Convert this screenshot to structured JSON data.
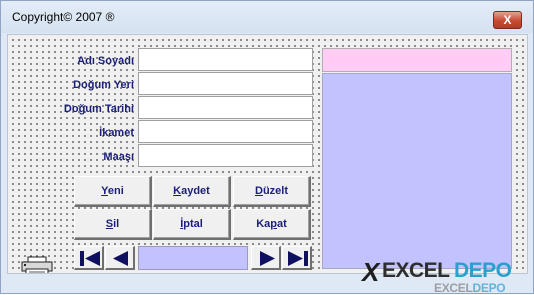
{
  "window": {
    "title": "Copyright© 2007 ®",
    "close_label": "X"
  },
  "form": {
    "fields": [
      {
        "label": "Adı Soyadı",
        "value": ""
      },
      {
        "label": "Doğum Yeri",
        "value": ""
      },
      {
        "label": "Doğum Tarihi",
        "value": ""
      },
      {
        "label": "İkamet",
        "value": ""
      },
      {
        "label": "Maaşı",
        "value": ""
      }
    ],
    "record_value": ""
  },
  "buttons": [
    {
      "accel": "Y",
      "rest": "eni"
    },
    {
      "accel": "K",
      "rest": "aydet"
    },
    {
      "accel": "D",
      "rest": "üzelt"
    },
    {
      "accel": "S",
      "rest": "il"
    },
    {
      "accel": "İ",
      "rest": "ptal"
    },
    {
      "pre": "Ka",
      "accel": "p",
      "rest": "at"
    }
  ],
  "navigation": {
    "first_icon": "first-record-icon",
    "prev_icon": "previous-record-icon",
    "next_icon": "next-record-icon",
    "last_icon": "last-record-icon"
  },
  "logo": {
    "mark": "X",
    "word1": "EXCEL",
    "word2": "DEPO",
    "reflection_word1": "EXCEL",
    "reflection_word2": "DEPO"
  },
  "colors": {
    "label_text": "#1b1f7a",
    "list_background": "#c2c2ff",
    "header_box": "#ffccf5",
    "logo_accent": "#2aa0cf"
  }
}
